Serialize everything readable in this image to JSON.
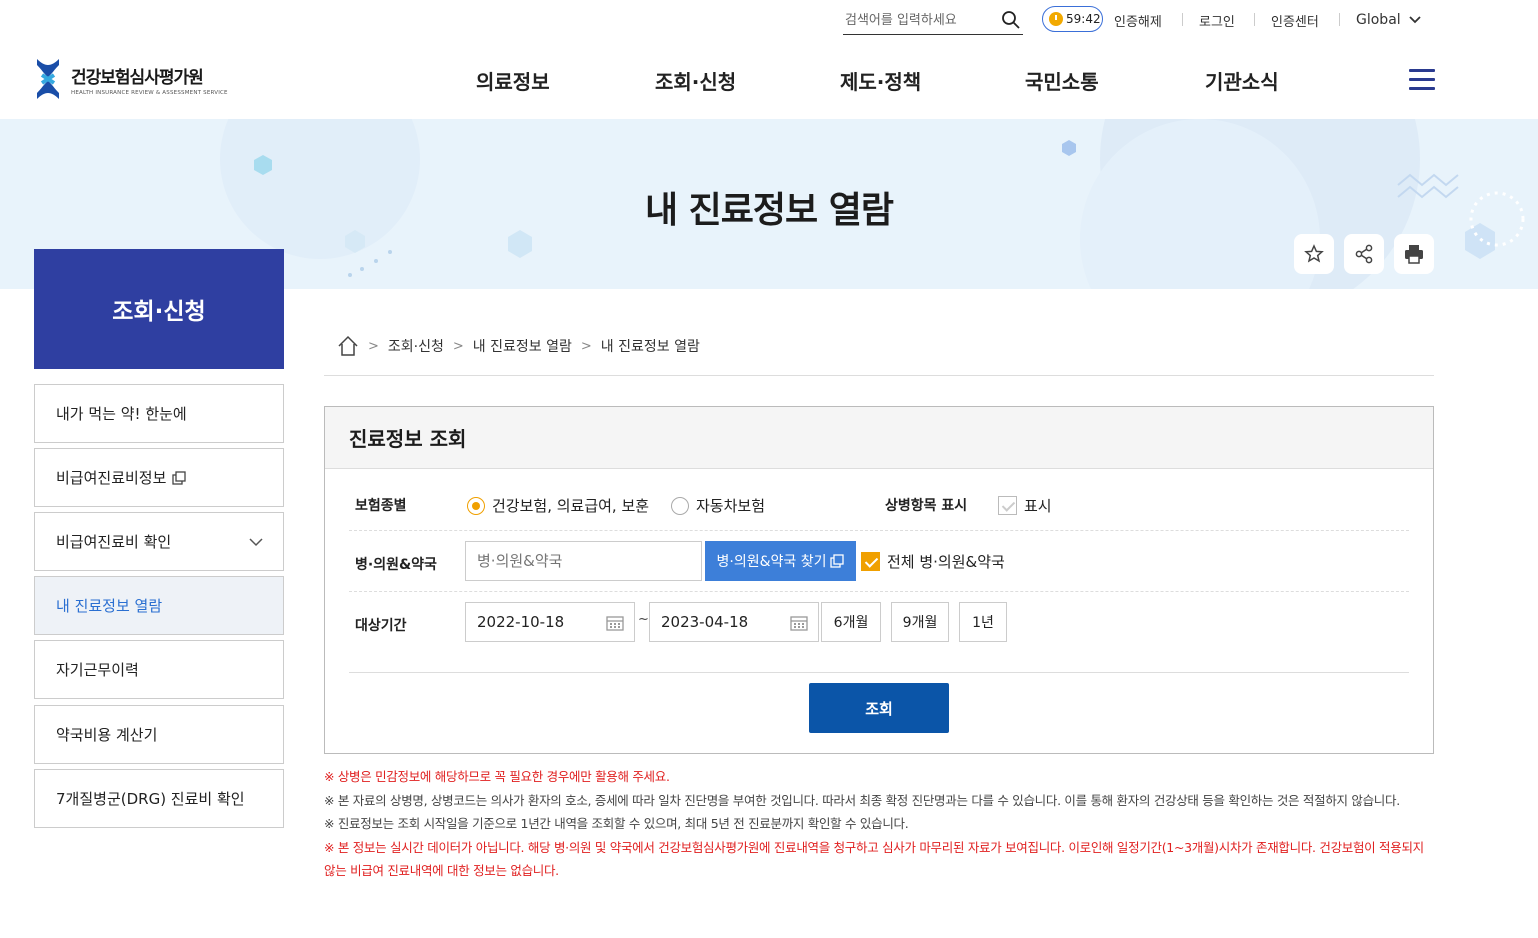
{
  "util": {
    "search_placeholder": "검색어를 입력하세요",
    "timer": "59:42",
    "logout_cert": "인증해제",
    "login": "로그인",
    "cert_center": "인증센터",
    "global": "Global"
  },
  "logo": {
    "name": "건강보험심사평가원",
    "sub": "HEALTH INSURANCE REVIEW & ASSESSMENT SERVICE"
  },
  "gnb": [
    "의료정보",
    "조회·신청",
    "제도·정책",
    "국민소통",
    "기관소식"
  ],
  "hero": {
    "title": "내 진료정보 열람"
  },
  "side": {
    "title": "조회·신청",
    "items": [
      "내가 먹는 약! 한눈에",
      "비급여진료비정보",
      "비급여진료비 확인",
      "내 진료정보 열람",
      "자기근무이력",
      "약국비용 계산기",
      "7개질병군(DRG) 진료비 확인"
    ]
  },
  "breadcrumb": [
    "조회·신청",
    "내 진료정보 열람",
    "내 진료정보 열람"
  ],
  "form": {
    "title": "진료정보 조회",
    "insurance_label": "보험종별",
    "radio1": "건강보험, 의료급여, 보훈",
    "radio2": "자동차보험",
    "disease_label": "상병항목 표시",
    "disease_check": "표시",
    "hospital_label": "병·의원&약국",
    "hospital_placeholder": "병·의원&약국",
    "find_btn": "병·의원&약국 찾기",
    "all_hospital": "전체 병·의원&약국",
    "period_label": "대상기간",
    "date_from": "2022-10-18",
    "tilde": "~",
    "date_to": "2023-04-18",
    "p6": "6개월",
    "p9": "9개월",
    "p12": "1년",
    "submit": "조회"
  },
  "notes": {
    "n1": "※ 상병은 민감정보에 해당하므로 꼭 필요한 경우에만 활용해 주세요.",
    "n2": "※ 본 자료의 상병명, 상병코드는 의사가 환자의 호소, 증세에 따라 일차 진단명을 부여한 것입니다. 따라서 최종 확정 진단명과는 다를 수 있습니다. 이를 통해 환자의 건강상태 등을 확인하는 것은 적절하지 않습니다.",
    "n3": "※ 진료정보는 조회 시작일을 기준으로 1년간 내역을 조회할 수 있으며, 최대 5년 전 진료분까지 확인할 수 있습니다.",
    "n4": "※ 본 정보는 실시간 데이터가 아닙니다. 해당 병·의원 및 약국에서 건강보험심사평가원에 진료내역을 청구하고 심사가 마무리된 자료가 보여집니다. 이로인해 일정기간(1~3개월)시차가 존재합니다. 건강보험이 적용되지 않는 비급여 진료내역에 대한 정보는 없습니다."
  },
  "colors": {
    "primary": "#2f3fa1",
    "button": "#0b55a8",
    "find": "#3d7fd9",
    "accent": "#f0a000",
    "warn": "#e02020"
  }
}
